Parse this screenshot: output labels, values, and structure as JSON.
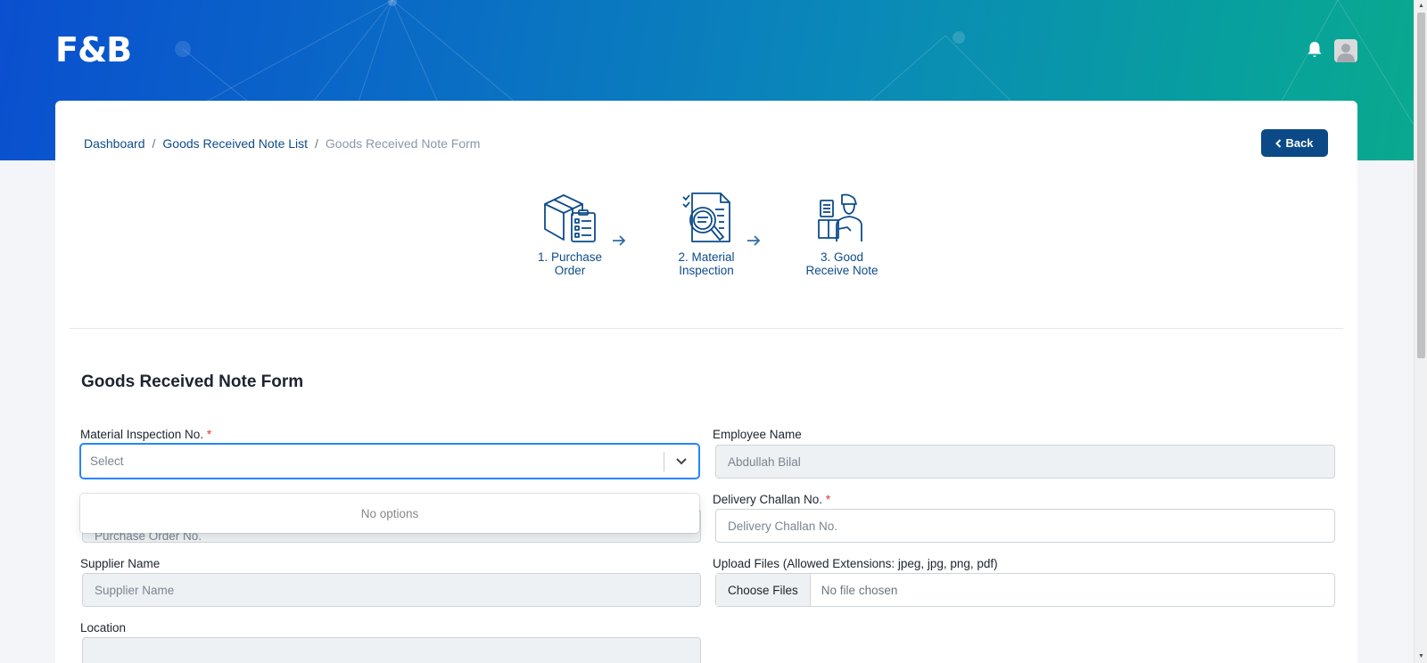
{
  "app": {
    "logo": "F&B"
  },
  "header": {
    "bell_icon": "bell-icon",
    "avatar_icon": "user-avatar-icon"
  },
  "breadcrumb": {
    "items": [
      "Dashboard",
      "Goods Received Note List",
      "Goods Received Note Form"
    ],
    "separator": "/"
  },
  "back_button": {
    "label": "Back",
    "icon": "chevron-left-icon"
  },
  "steps": [
    {
      "line1": "1. Purchase",
      "line2": "Order",
      "icon": "box-clipboard-icon"
    },
    {
      "line1": "2. Material",
      "line2": "Inspection",
      "icon": "document-magnifier-icon"
    },
    {
      "line1": "3. Good",
      "line2": "Receive Note",
      "icon": "delivery-person-icon"
    }
  ],
  "form": {
    "title": "Goods Received Note Form",
    "material_inspection": {
      "label": "Material Inspection No.",
      "required": "*",
      "placeholder": "Select",
      "dropdown_message": "No options"
    },
    "employee_name": {
      "label": "Employee Name",
      "value": "Abdullah Bilal"
    },
    "purchase_order": {
      "placeholder": "Purchase Order No."
    },
    "delivery_challan": {
      "label": "Delivery Challan No.",
      "required": "*",
      "placeholder": "Delivery Challan No."
    },
    "supplier_name": {
      "label": "Supplier Name",
      "placeholder": "Supplier Name"
    },
    "upload_files": {
      "label": "Upload Files (Allowed Extensions: jpeg, jpg, png, pdf)",
      "button": "Choose Files",
      "status": "No file chosen"
    },
    "location": {
      "label": "Location"
    }
  },
  "colors": {
    "primary": "#0b4a86",
    "link": "#0e4c8a",
    "focus": "#2684ff",
    "required": "#e03131"
  }
}
